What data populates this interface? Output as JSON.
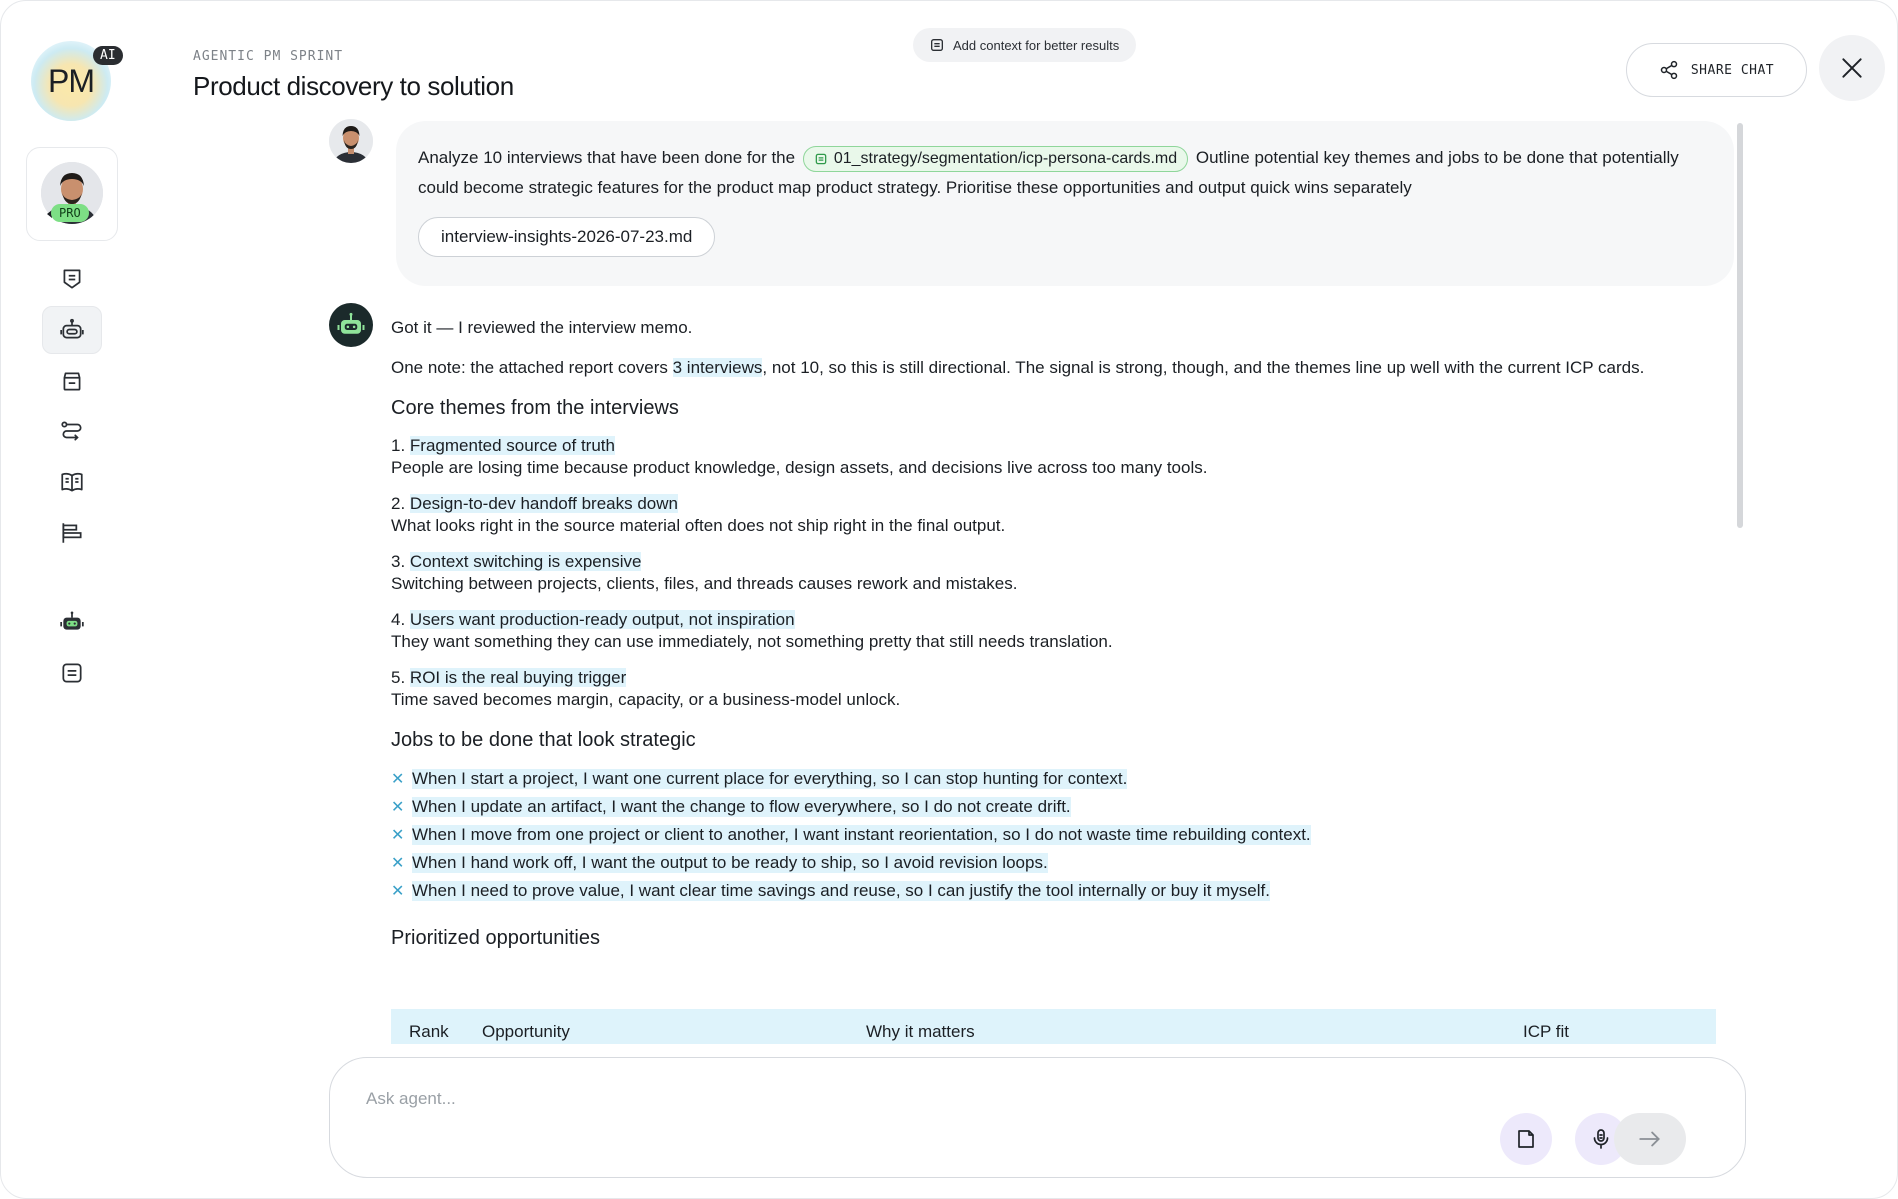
{
  "brand": {
    "logo_text": "PM",
    "ai_badge": "AI"
  },
  "profile": {
    "badge": "PRO"
  },
  "header": {
    "eyebrow": "AGENTIC PM SPRINT",
    "title": "Product discovery to solution",
    "context_button": "Add context for better results",
    "share_button": "SHARE CHAT"
  },
  "sidebar": {
    "items": [
      {
        "icon": "shield-list-icon"
      },
      {
        "icon": "robot-icon",
        "active": true
      },
      {
        "icon": "archive-box-icon"
      },
      {
        "icon": "route-icon"
      },
      {
        "icon": "book-icon"
      },
      {
        "icon": "timeline-bars-icon"
      },
      {
        "icon": "robot-green-icon"
      },
      {
        "icon": "note-icon"
      }
    ]
  },
  "user_message": {
    "text_before": "Analyze 10 interviews that have been done for the",
    "file_chip": "01_strategy/segmentation/icp-persona-cards.md",
    "text_after": "Outline potential key themes and jobs to be done that potentially could become strategic features for the product map product strategy. Prioritise these opportunities and output quick wins separately",
    "attachment": "interview-insights-2026-07-23.md"
  },
  "assistant": {
    "intro": "Got it — I reviewed the interview memo.",
    "note_before": "One note: the attached report covers",
    "note_highlight": "3 interviews",
    "note_after": ", not 10, so this is still directional. The signal is strong, though, and the themes line up well with the current ICP cards.",
    "themes_heading": "Core themes from the interviews",
    "themes": [
      {
        "num": "1.",
        "title": "Fragmented source of truth",
        "desc": "People are losing time because product knowledge, design assets, and decisions live across too many tools."
      },
      {
        "num": "2.",
        "title": "Design-to-dev handoff breaks down",
        "desc": "What looks right in the source material often does not ship right in the final output."
      },
      {
        "num": "3.",
        "title": "Context switching is expensive",
        "desc": "Switching between projects, clients, files, and threads causes rework and mistakes."
      },
      {
        "num": "4.",
        "title": "Users want production-ready output, not inspiration",
        "desc": "They want something they can use immediately, not something pretty that still needs translation."
      },
      {
        "num": "5.",
        "title": "ROI is the real buying trigger",
        "desc": "Time saved becomes margin, capacity, or a business-model unlock."
      }
    ],
    "jobs_heading": "Jobs to be done that look strategic",
    "jobs": [
      "When I start a project, I want one current place for everything, so I can stop hunting for context.",
      "When I update an artifact, I want the change to flow everywhere, so I do not create drift.",
      "When I move from one project or client to another, I want instant reorientation, so I do not waste time rebuilding context.",
      "When I hand work off, I want the output to be ready to ship, so I avoid revision loops.",
      "When I need to prove value, I want clear time savings and reuse, so I can justify the tool internally or buy it myself."
    ],
    "opportunities_heading": "Prioritized opportunities",
    "table_headers": [
      "Rank",
      "Opportunity",
      "Why it matters",
      "ICP fit"
    ]
  },
  "composer": {
    "placeholder": "Ask agent..."
  },
  "colors": {
    "highlight": "#dff3fb",
    "accent_green": "#7ddf85",
    "composer_button": "#ede9fb"
  }
}
